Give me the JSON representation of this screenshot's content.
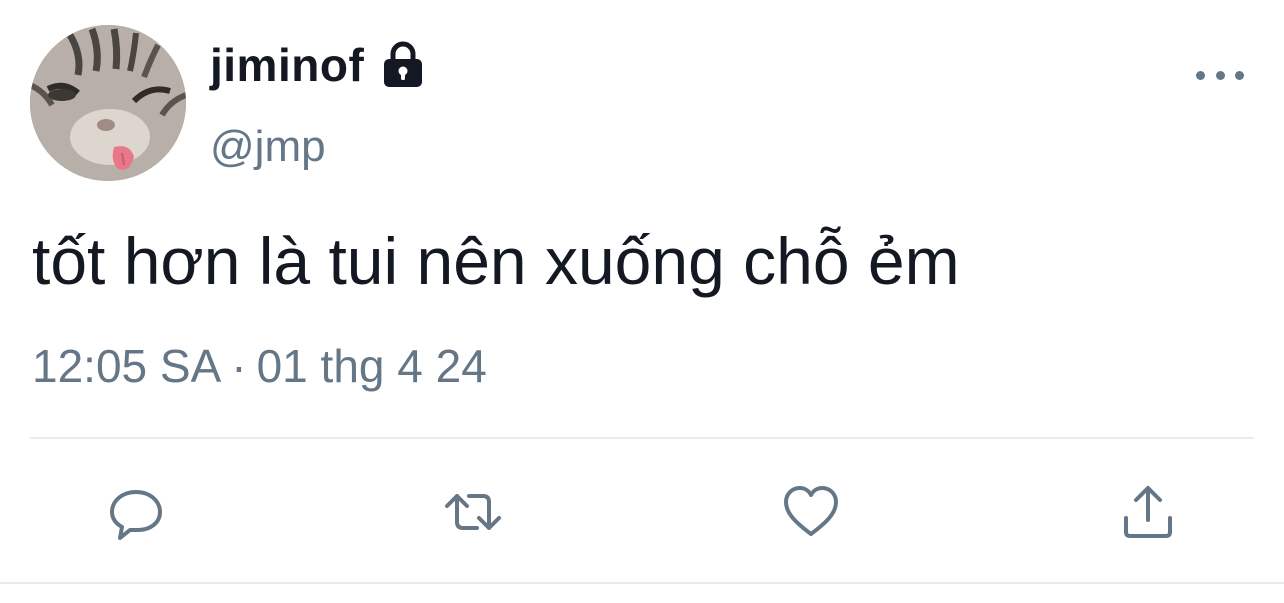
{
  "author": {
    "display_name": "jiminof",
    "handle": "@jmp",
    "protected_icon": "lock-icon",
    "avatar": "cat-avatar"
  },
  "tweet": {
    "text": "tốt hơn là tui nên xuống chỗ ẻm",
    "time": "12:05 SA",
    "separator": "·",
    "date": "01 thg 4 24"
  },
  "actions": [
    {
      "icon": "reply-icon"
    },
    {
      "icon": "retweet-icon"
    },
    {
      "icon": "like-icon"
    },
    {
      "icon": "share-icon"
    }
  ],
  "menu_icon": "more-options-icon",
  "colors": {
    "text": "#141823",
    "secondary": "#657786",
    "divider": "#e6ecf0"
  }
}
